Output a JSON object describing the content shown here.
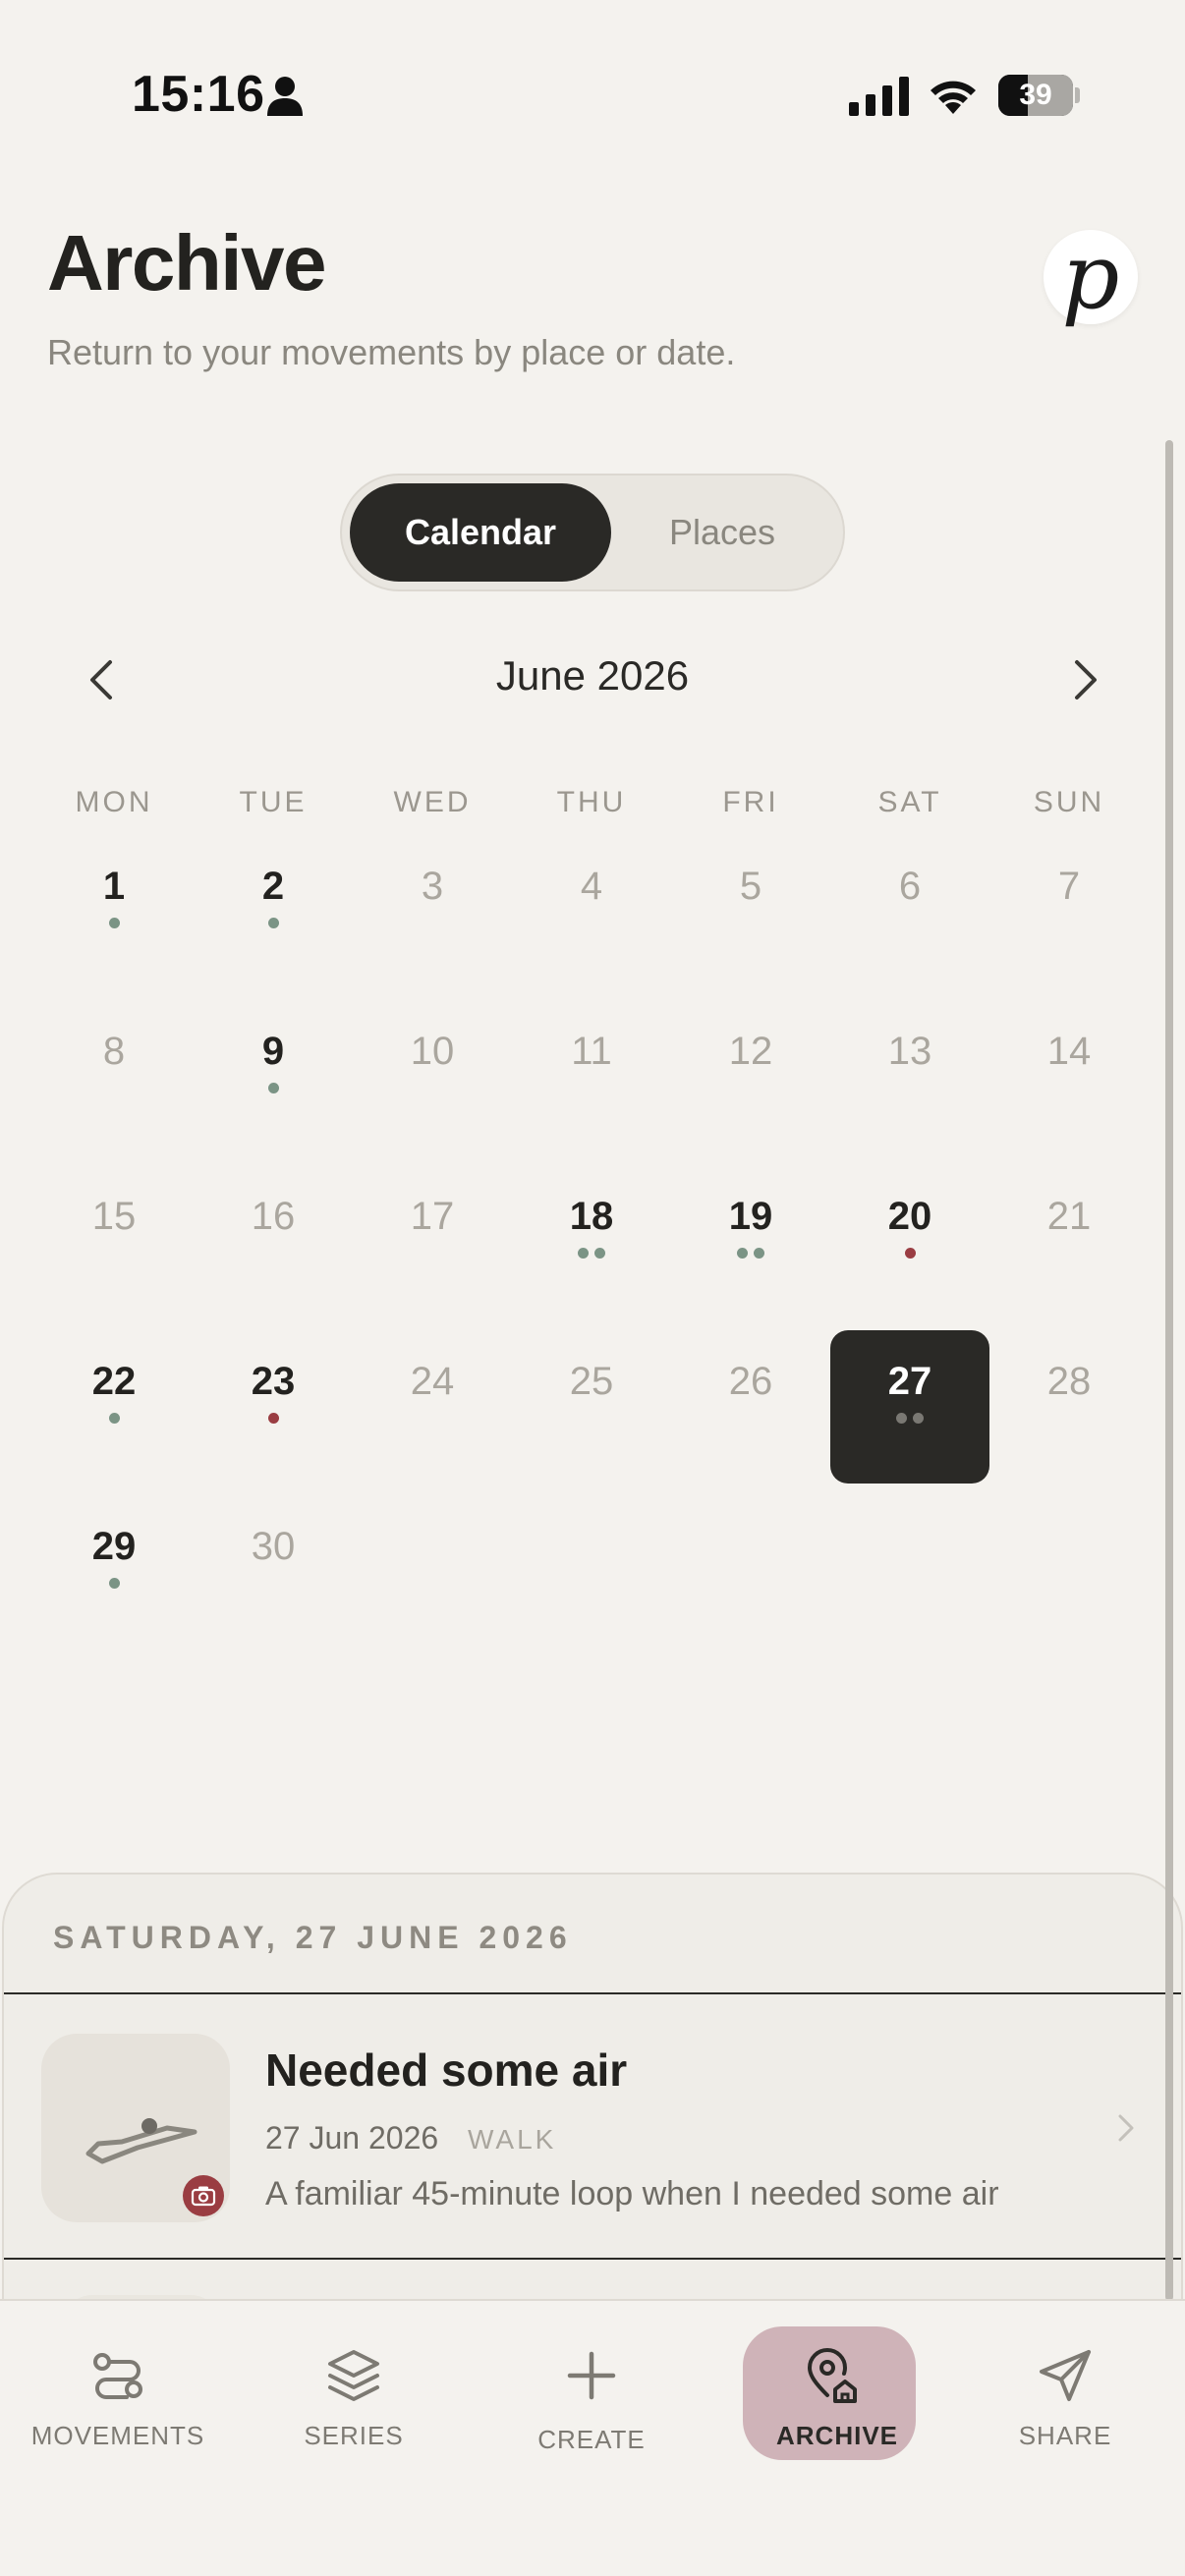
{
  "status_bar": {
    "time": "15:16",
    "battery": "39",
    "battery_level": 0.39
  },
  "header": {
    "title": "Archive",
    "subtitle": "Return to your movements by place or date.",
    "avatar_letter": "p"
  },
  "segmented": {
    "options": [
      "Calendar",
      "Places"
    ],
    "selected": "Calendar"
  },
  "calendar": {
    "month_label": "June 2026",
    "weekdays": [
      "MON",
      "TUE",
      "WED",
      "THU",
      "FRI",
      "SAT",
      "SUN"
    ],
    "first_weekday_index": 0,
    "days_in_month": 30,
    "selected_day": 27,
    "colors": {
      "green_dot": "#7b9485",
      "red_dot": "#9a3d42",
      "selected_dot": "#7a7873"
    },
    "entries": {
      "1": [
        "green"
      ],
      "2": [
        "green"
      ],
      "9": [
        "green"
      ],
      "18": [
        "green",
        "green"
      ],
      "19": [
        "green",
        "green"
      ],
      "20": [
        "red"
      ],
      "22": [
        "green"
      ],
      "23": [
        "red"
      ],
      "27": [
        "grey",
        "grey"
      ],
      "29": [
        "green"
      ]
    }
  },
  "sheet": {
    "heading": "SATURDAY, 27 JUNE 2026",
    "entry": {
      "title": "Needed some air",
      "date": "27 Jun 2026",
      "type": "WALK",
      "description": "A familiar 45-minute loop when I needed some air",
      "thumb_icon": "route-icon",
      "badge_icon": "camera-icon"
    }
  },
  "tabbar": {
    "tabs": [
      {
        "label": "MOVEMENTS",
        "icon": "route-path-icon"
      },
      {
        "label": "SERIES",
        "icon": "layers-icon"
      },
      {
        "label": "CREATE",
        "icon": "plus-icon"
      },
      {
        "label": "ARCHIVE",
        "icon": "map-pin-home-icon"
      },
      {
        "label": "SHARE",
        "icon": "send-icon"
      }
    ],
    "active": "ARCHIVE",
    "active_color": "#cfb3b8"
  }
}
